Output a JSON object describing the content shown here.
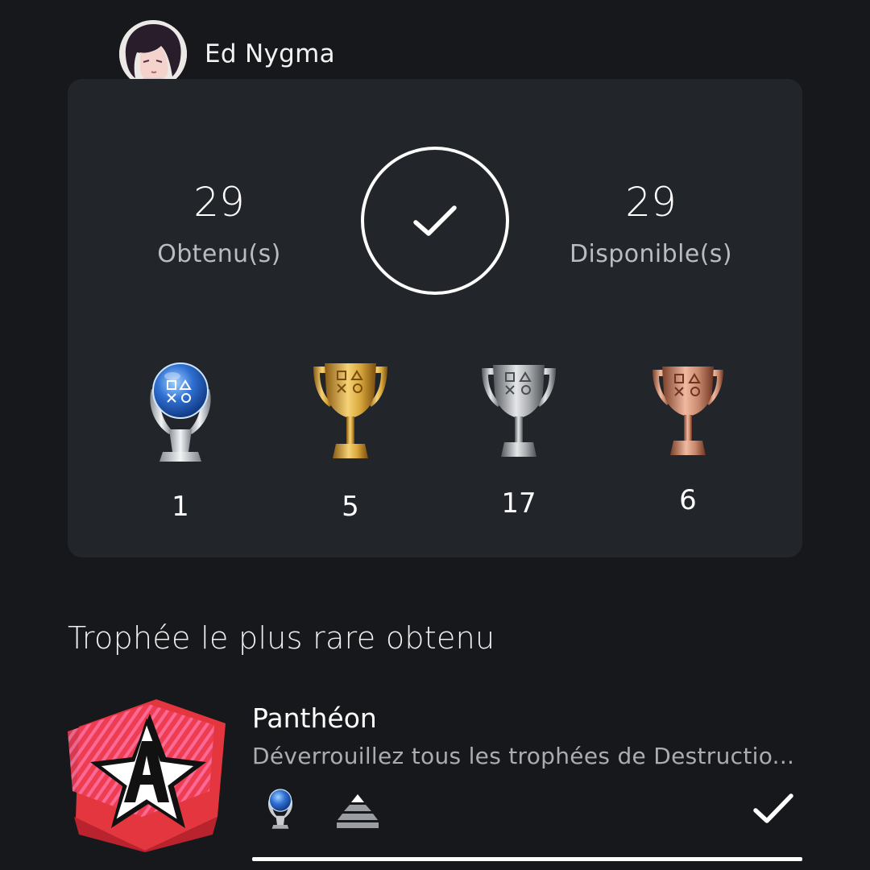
{
  "profile": {
    "username": "Ed Nygma",
    "avatar_icon": "user-avatar"
  },
  "summary": {
    "earned_value": "29",
    "earned_label": "Obtenu(s)",
    "available_value": "29",
    "available_label": "Disponible(s)",
    "completion_icon": "check-icon",
    "completion_percent": 100
  },
  "trophies": [
    {
      "type": "platinum",
      "count": "1",
      "icon": "platinum-trophy-icon"
    },
    {
      "type": "gold",
      "count": "5",
      "icon": "gold-trophy-icon"
    },
    {
      "type": "silver",
      "count": "17",
      "icon": "silver-trophy-icon"
    },
    {
      "type": "bronze",
      "count": "6",
      "icon": "bronze-trophy-icon"
    }
  ],
  "rarest": {
    "section_title": "Trophée le plus rare obtenu",
    "name": "Panthéon",
    "description": "Déverrouillez tous les trophées de Destructio...",
    "type_icon": "platinum-trophy-icon",
    "rarity_icon": "rarity-pyramid-icon",
    "status_icon": "check-icon"
  },
  "colors": {
    "background": "#17181b",
    "card": "#22252a",
    "muted_text": "#b9bcc1",
    "platinum": "#3d7fd6",
    "gold": "#d6a53a",
    "silver": "#b5b7ba",
    "bronze": "#c98a6e"
  }
}
